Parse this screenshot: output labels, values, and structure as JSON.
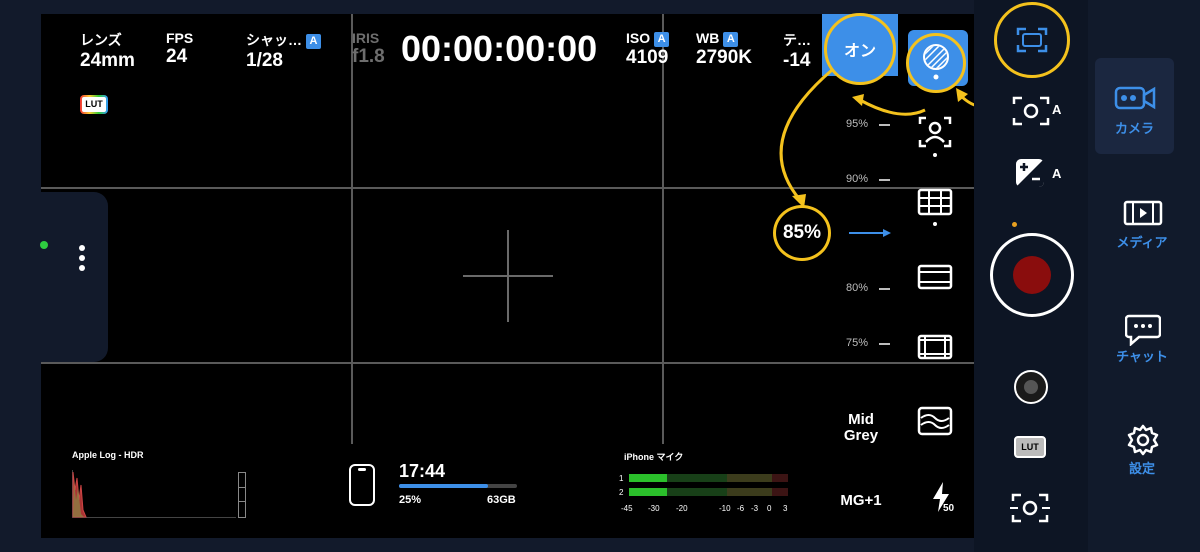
{
  "top_info": {
    "lens": {
      "label": "レンズ",
      "value": "24mm"
    },
    "fps": {
      "label": "FPS",
      "value": "24"
    },
    "shutter": {
      "label": "シャッ…",
      "value": "1/28",
      "badge": "A"
    },
    "iris": {
      "label": "IRIS",
      "value": "f1.8"
    },
    "timecode": "00:00:00:00",
    "iso": {
      "label": "ISO",
      "value": "4109",
      "badge": "A"
    },
    "wb": {
      "label": "WB",
      "value": "2790K",
      "badge": "A"
    },
    "tint": {
      "label": "テ…",
      "value": "-14"
    }
  },
  "lut_badge": "LUT",
  "zebra": {
    "toggle_label": "オン",
    "level_label": "85%",
    "level": 85,
    "scale": [
      "95%",
      "90%",
      "80%",
      "75%"
    ]
  },
  "exposure_tools": {
    "mid_grey_label": "Mid Grey",
    "mg_plus_label": "MG+1",
    "flash_value": "50"
  },
  "bottom": {
    "log_label": "Apple Log - HDR",
    "time_remaining": "17:44",
    "battery": "25%",
    "storage": "63GB",
    "storage_fill": 0.75,
    "mic_label": "iPhone マイク",
    "channels": [
      "1",
      "2"
    ],
    "meter_scale": [
      "-45",
      "-30",
      "-20",
      "-10",
      "-6",
      "-3",
      "0",
      "3"
    ]
  },
  "right_panel": {
    "auto_label": "A",
    "lut_label": "LUT"
  },
  "nav": {
    "camera": "カメラ",
    "media": "メディア",
    "chat": "チャット",
    "settings": "設定"
  },
  "colors": {
    "accent": "#3d8fe8",
    "highlight": "#f4c21d",
    "record": "#8a0d0d",
    "status_dot": "#2ecc40"
  }
}
